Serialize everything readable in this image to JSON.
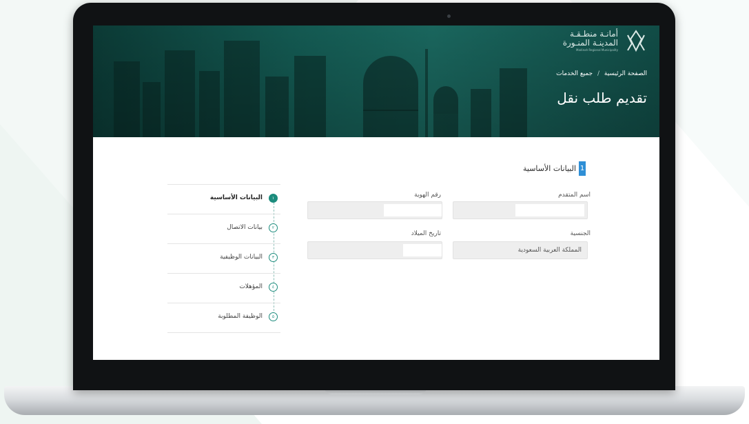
{
  "site": {
    "logo_line1": "أمانـة منطـقـة",
    "logo_line2": "المدينـة المنـورة",
    "logo_line3": "Madinah Regional Municipality"
  },
  "breadcrumb": {
    "home": "الصفحة الرئيسية",
    "separator": "/",
    "current": "جميع الخدمات"
  },
  "page_title": "تقديم طلب نقل",
  "form": {
    "section_number": "1",
    "section_title": "البيانات الأساسية",
    "applicant_name_label": "اسم المتقدم",
    "id_number_label": "رقم الهوية",
    "nationality_label": "الجنسية",
    "nationality_value": "المملكة العربية السعودية",
    "birth_date_label": "تاريخ الميلاد"
  },
  "steps": [
    {
      "num": "١",
      "label": "البيانات الأساسية",
      "active": true
    },
    {
      "num": "٢",
      "label": "بيانات الاتصال",
      "active": false
    },
    {
      "num": "٣",
      "label": "البيانات الوظيفية",
      "active": false
    },
    {
      "num": "٤",
      "label": "المؤهلات",
      "active": false
    },
    {
      "num": "٥",
      "label": "الوظيفة المطلوبة",
      "active": false
    }
  ],
  "colors": {
    "brand_green": "#1c8c7d",
    "hero_dark": "#0c3d38",
    "section_accent": "#2f8fd6"
  }
}
